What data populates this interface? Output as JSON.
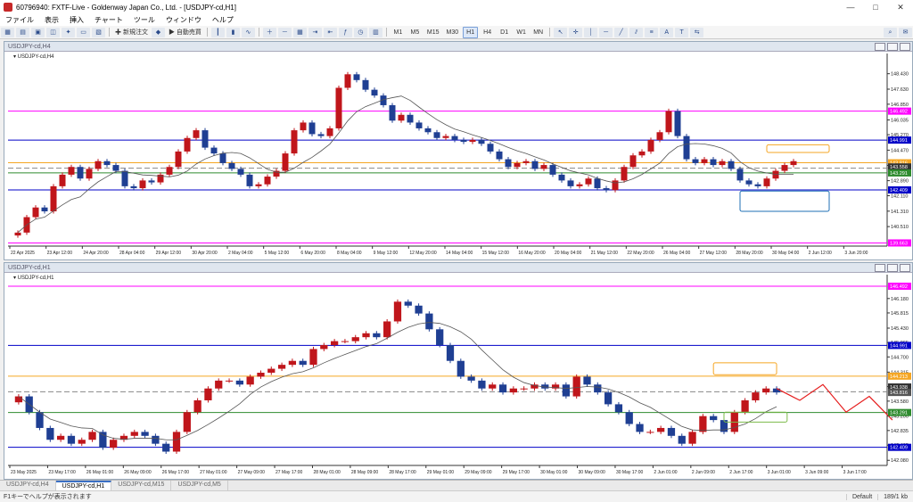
{
  "window": {
    "title": "60796940: FXTF-Live - Goldenway Japan Co., Ltd. - [USDJPY-cd,H1]"
  },
  "menu": {
    "items": [
      "ファイル",
      "表示",
      "挿入",
      "チャート",
      "ツール",
      "ウィンドウ",
      "ヘルプ"
    ]
  },
  "toolbar": {
    "new_order_label": "新規注文",
    "auto_trade_label": "自動売買",
    "timeframes": [
      "M1",
      "M5",
      "M15",
      "M30",
      "H1",
      "H4",
      "D1",
      "W1",
      "MN"
    ],
    "active_timeframe": "H1"
  },
  "charts": [
    {
      "window_title": "USDJPY-cd,H4",
      "label": "USDJPY-cd,H4",
      "chart_data": {
        "type": "candlestick",
        "symbol": "USDJPY-cd",
        "timeframe": "H4",
        "ylim": [
          139.5,
          149.2
        ],
        "y_ticks": [
          148.43,
          147.63,
          146.85,
          146.035,
          145.27,
          144.47,
          143.68,
          142.89,
          142.11,
          141.31,
          140.51
        ],
        "x_ticks": [
          "22 Apr 2025",
          "23 Apr 12:00",
          "24 Apr 20:00",
          "28 Apr 04:00",
          "29 Apr 12:00",
          "30 Apr 20:00",
          "2 May 04:00",
          "5 May 12:00",
          "6 May 20:00",
          "8 May 04:00",
          "9 May 12:00",
          "12 May 20:00",
          "14 May 04:00",
          "15 May 12:00",
          "16 May 20:00",
          "20 May 04:00",
          "21 May 12:00",
          "22 May 20:00",
          "26 May 04:00",
          "27 May 12:00",
          "28 May 20:00",
          "30 May 04:00",
          "2 Jun 12:00",
          "3 Jun 20:00"
        ],
        "closes": [
          140.2,
          141.0,
          141.5,
          141.3,
          142.6,
          143.2,
          143.6,
          143.0,
          143.5,
          143.9,
          143.7,
          143.4,
          142.6,
          142.5,
          142.9,
          142.8,
          143.2,
          143.6,
          144.4,
          145.1,
          145.5,
          144.6,
          144.3,
          143.8,
          143.5,
          143.2,
          142.6,
          142.7,
          143.1,
          143.4,
          144.3,
          145.5,
          145.9,
          145.3,
          145.2,
          145.6,
          147.7,
          148.4,
          148.1,
          147.6,
          147.3,
          146.8,
          146.0,
          146.3,
          145.9,
          145.6,
          145.4,
          145.1,
          145.2,
          145.0,
          144.9,
          145.0,
          144.8,
          144.4,
          144.0,
          143.6,
          143.8,
          143.9,
          143.5,
          143.7,
          143.2,
          142.9,
          142.6,
          142.7,
          143.0,
          142.5,
          142.4,
          142.9,
          143.6,
          144.2,
          144.4,
          145.0,
          145.4,
          146.5,
          145.2,
          144.0,
          143.8,
          144.0,
          143.7,
          143.9,
          143.5,
          142.9,
          142.7,
          142.6,
          143.0,
          143.4,
          143.7,
          143.9
        ],
        "horizontal_levels": [
          {
            "price": 146.492,
            "color": "#ff00ff"
          },
          {
            "price": 144.991,
            "color": "#0000c8"
          },
          {
            "price": 143.816,
            "color": "#f5a623"
          },
          {
            "price": 143.538,
            "color": "#888888",
            "style": "dashed"
          },
          {
            "price": 143.291,
            "color": "#2e8b2e"
          },
          {
            "price": 142.409,
            "color": "#0000c8"
          },
          {
            "price": 139.663,
            "color": "#ff00ff"
          }
        ],
        "price_labels": [
          {
            "text": "146.492",
            "price": 146.492,
            "color": "#ff00ff"
          },
          {
            "text": "144.991",
            "price": 144.991,
            "color": "#0000c8"
          },
          {
            "text": "143.816",
            "price": 143.816,
            "color": "#f5a623"
          },
          {
            "text": "143.558",
            "price": 143.6,
            "color": "#333333"
          },
          {
            "text": "143.291",
            "price": 143.291,
            "color": "#2e8b2e"
          },
          {
            "text": "142.409",
            "price": 142.409,
            "color": "#0000c8"
          },
          {
            "text": "139.663",
            "price": 139.663,
            "color": "#ff00ff"
          }
        ],
        "annotations": [
          {
            "shape": "rect",
            "color": "#f5a623",
            "price_top": 144.75,
            "price_bottom": 144.35,
            "from_bar": 84,
            "to_bar": 91
          },
          {
            "shape": "rect",
            "color": "#1f6fb5",
            "price_top": 142.35,
            "price_bottom": 141.3,
            "from_bar": 81,
            "to_bar": 91
          }
        ]
      }
    },
    {
      "window_title": "USDJPY-cd,H1",
      "label": "USDJPY-cd,H1",
      "chart_data": {
        "type": "candlestick",
        "symbol": "USDJPY-cd",
        "timeframe": "H1",
        "ylim": [
          141.95,
          146.65
        ],
        "y_ticks": [
          146.18,
          145.815,
          145.43,
          145.065,
          144.7,
          144.315,
          143.95,
          143.58,
          143.2,
          142.835,
          142.465,
          142.08
        ],
        "x_ticks": [
          "23 May 2025",
          "23 May 17:00",
          "26 May 01:00",
          "26 May 09:00",
          "26 May 17:00",
          "27 May 01:00",
          "27 May 09:00",
          "27 May 17:00",
          "28 May 01:00",
          "28 May 09:00",
          "28 May 17:00",
          "29 May 01:00",
          "29 May 09:00",
          "29 May 17:00",
          "30 May 01:00",
          "30 May 09:00",
          "30 May 17:00",
          "2 Jun 01:00",
          "2 Jun 09:00",
          "2 Jun 17:00",
          "3 Jun 01:00",
          "3 Jun 09:00",
          "3 Jun 17:00"
        ],
        "closes": [
          143.7,
          143.3,
          142.9,
          142.6,
          142.7,
          142.5,
          142.6,
          142.8,
          142.4,
          142.6,
          142.7,
          142.8,
          142.7,
          142.5,
          142.3,
          142.8,
          143.3,
          143.6,
          143.9,
          144.1,
          144.1,
          144.0,
          144.2,
          144.3,
          144.4,
          144.5,
          144.6,
          144.5,
          144.9,
          145.0,
          145.1,
          145.1,
          145.2,
          145.3,
          145.2,
          145.6,
          146.1,
          146.0,
          145.8,
          145.4,
          145.0,
          144.6,
          144.2,
          144.1,
          143.9,
          144.0,
          143.8,
          143.9,
          143.9,
          144.0,
          143.9,
          144.0,
          143.7,
          144.2,
          144.0,
          143.8,
          143.5,
          143.3,
          143.0,
          142.8,
          142.8,
          142.9,
          142.7,
          142.5,
          142.8,
          143.2,
          143.1,
          142.8,
          143.3,
          143.6,
          143.8,
          143.9,
          143.8
        ],
        "horizontal_levels": [
          {
            "price": 146.492,
            "color": "#ff00ff"
          },
          {
            "price": 144.991,
            "color": "#0000c8"
          },
          {
            "price": 144.213,
            "color": "#f5a623"
          },
          {
            "price": 143.816,
            "color": "#888888",
            "style": "dashed"
          },
          {
            "price": 143.291,
            "color": "#2e8b2e"
          },
          {
            "price": 142.409,
            "color": "#0000c8"
          }
        ],
        "price_labels": [
          {
            "text": "146.492",
            "price": 146.492,
            "color": "#ff00ff"
          },
          {
            "text": "144.991",
            "price": 144.991,
            "color": "#0000c8"
          },
          {
            "text": "144.213",
            "price": 144.213,
            "color": "#f5a623"
          },
          {
            "text": "143.938",
            "price": 143.938,
            "color": "#333333"
          },
          {
            "text": "143.816",
            "price": 143.8,
            "color": "#555555"
          },
          {
            "text": "143.291",
            "price": 143.291,
            "color": "#2e8b2e"
          },
          {
            "text": "142.409",
            "price": 142.409,
            "color": "#0000c8"
          }
        ],
        "annotations": [
          {
            "shape": "rect",
            "color": "#f5a623",
            "price_top": 144.55,
            "price_bottom": 144.25,
            "from_bar": 66,
            "to_bar": 72
          },
          {
            "shape": "rect",
            "color": "#7cbb4a",
            "price_top": 143.3,
            "price_bottom": 143.05,
            "from_bar": 67,
            "to_bar": 73
          }
        ],
        "forecast_path": [
          143.9,
          143.6,
          144.0,
          143.3,
          143.7,
          143.1
        ]
      }
    }
  ],
  "tabs": [
    "USDJPY-cd,H4",
    "USDJPY-cd,H1",
    "USDJPY-cd,M15",
    "USDJPY-cd,M5"
  ],
  "active_tab": 1,
  "status": {
    "help_text": "F1キーでヘルプが表示されます",
    "profile": "Default",
    "bars": "189/1 kb"
  }
}
